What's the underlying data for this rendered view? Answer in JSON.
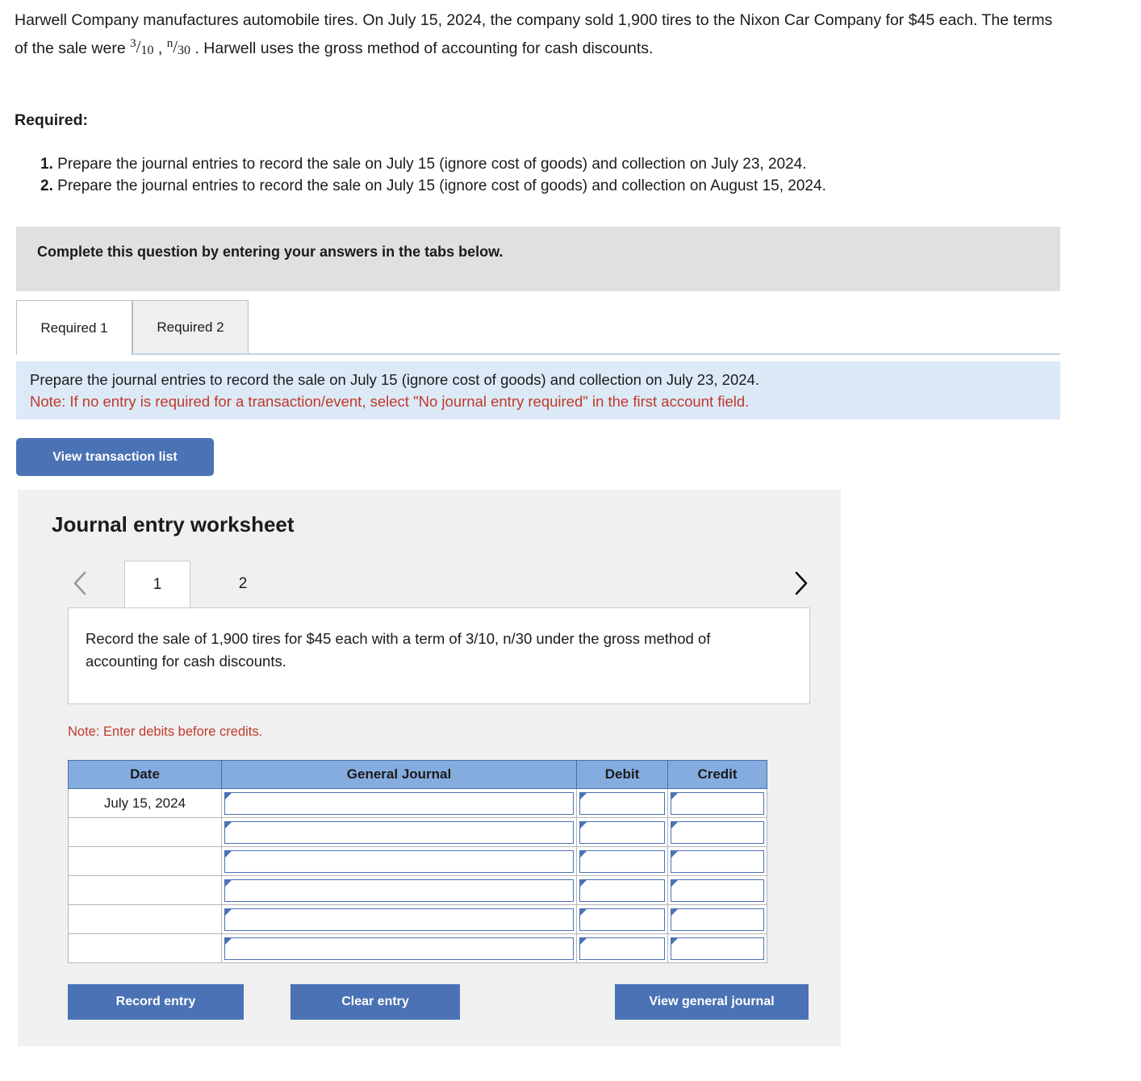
{
  "problem": {
    "part1": "Harwell Company manufactures automobile tires. On July 15, 2024, the company sold 1,900 tires to the Nixon Car Company for $45 each. The terms of the sale were ",
    "frac1_num": "3",
    "frac1_den": "10",
    "separator": " , ",
    "frac2_num": "n",
    "frac2_den": "30",
    "part2": " . Harwell uses the gross method of accounting for cash discounts."
  },
  "required": {
    "label": "Required:",
    "items": [
      {
        "num": "1.",
        "text": "Prepare the journal entries to record the sale on July 15 (ignore cost of goods) and collection on July 23, 2024."
      },
      {
        "num": "2.",
        "text": "Prepare the journal entries to record the sale on July 15 (ignore cost of goods) and collection on August 15, 2024."
      }
    ]
  },
  "banner": {
    "text": "Complete this question by entering your answers in the tabs below."
  },
  "tabs": [
    {
      "label": "Required 1",
      "active": true
    },
    {
      "label": "Required 2",
      "active": false
    }
  ],
  "info_panel": {
    "line1": "Prepare the journal entries to record the sale on July 15 (ignore cost of goods) and collection on July 23, 2024.",
    "line2": "Note: If no entry is required for a transaction/event, select \"No journal entry required\" in the first account field."
  },
  "buttons": {
    "view_transaction_list": "View transaction list",
    "record_entry": "Record entry",
    "clear_entry": "Clear entry",
    "view_general_journal": "View general journal"
  },
  "worksheet": {
    "title": "Journal entry worksheet",
    "pager": {
      "prev_icon": "chevron-left-icon",
      "next_icon": "chevron-right-icon",
      "pages": [
        {
          "label": "1",
          "active": true
        },
        {
          "label": "2",
          "active": false
        }
      ]
    },
    "description": "Record the sale of 1,900 tires for $45 each with a term of 3/10, n/30 under the gross method of accounting for cash discounts.",
    "note": "Note: Enter debits before credits.",
    "table": {
      "headers": [
        "Date",
        "General Journal",
        "Debit",
        "Credit"
      ],
      "rows": [
        {
          "date": "July 15, 2024",
          "general_journal": "",
          "debit": "",
          "credit": ""
        },
        {
          "date": "",
          "general_journal": "",
          "debit": "",
          "credit": ""
        },
        {
          "date": "",
          "general_journal": "",
          "debit": "",
          "credit": ""
        },
        {
          "date": "",
          "general_journal": "",
          "debit": "",
          "credit": ""
        },
        {
          "date": "",
          "general_journal": "",
          "debit": "",
          "credit": ""
        },
        {
          "date": "",
          "general_journal": "",
          "debit": "",
          "credit": ""
        }
      ]
    }
  },
  "colors": {
    "primary_button": "#4a72b4",
    "table_header": "#85acdf",
    "info_panel": "#dce9f7",
    "banner": "#e0e0e0",
    "note_red": "#c0392b"
  }
}
